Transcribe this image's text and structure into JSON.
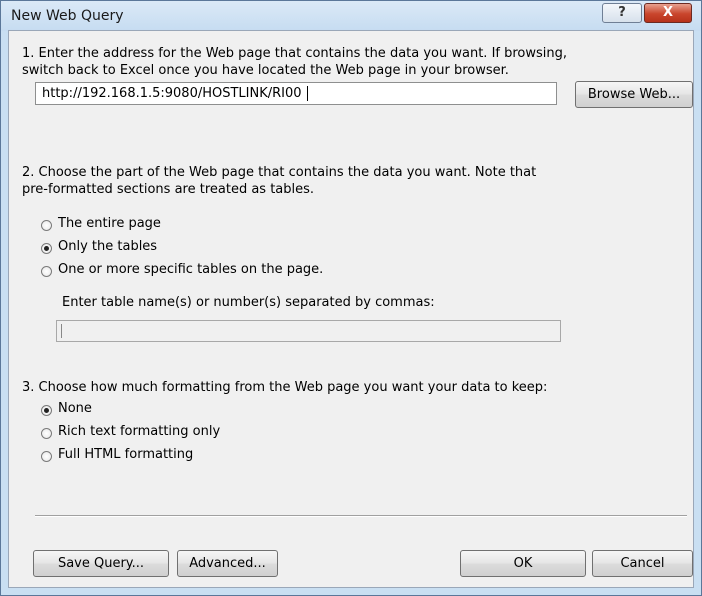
{
  "window": {
    "title": "New Web Query",
    "help_glyph": "?",
    "close_glyph": "X"
  },
  "step1": {
    "line1": "1. Enter the address for the Web page that contains the data you want.  If browsing,",
    "line2": "switch back to Excel once you have located the Web page in your browser.",
    "address_value": "http://192.168.1.5:9080/HOSTLINK/RI00",
    "browse_button": "Browse Web..."
  },
  "step2": {
    "line1": "2. Choose the part of the Web page that contains the data you want.  Note that",
    "line2": "pre-formatted sections are treated as tables.",
    "options": [
      {
        "label": "The entire page",
        "selected": false
      },
      {
        "label": "Only the tables",
        "selected": true
      },
      {
        "label": "One or more specific tables on the page.",
        "selected": false
      }
    ],
    "table_names_label": "Enter table name(s) or number(s) separated by commas:",
    "table_names_value": ""
  },
  "step3": {
    "line1": "3. Choose how much formatting from the Web page you want your data to keep:",
    "options": [
      {
        "label": "None",
        "selected": true
      },
      {
        "label": "Rich text formatting only",
        "selected": false
      },
      {
        "label": "Full HTML formatting",
        "selected": false
      }
    ]
  },
  "buttons": {
    "save_query": "Save Query...",
    "advanced": "Advanced...",
    "ok": "OK",
    "cancel": "Cancel"
  }
}
